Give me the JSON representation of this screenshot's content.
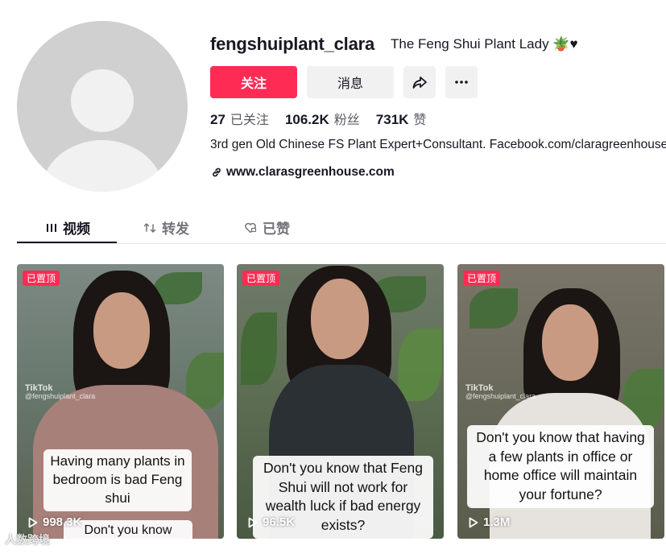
{
  "profile": {
    "username": "fengshuiplant_clara",
    "nickname": "The Feng Shui Plant Lady 🪴♥",
    "bio": "3rd gen Old Chinese FS Plant Expert+Consultant. Facebook.com/claragreenhouse",
    "link": "www.clarasgreenhouse.com"
  },
  "actions": {
    "follow_label": "关注",
    "message_label": "消息",
    "share_icon": "share-icon",
    "more_icon": "more-icon"
  },
  "stats": [
    {
      "value": "27",
      "label": "已关注"
    },
    {
      "value": "106.2K",
      "label": "粉丝"
    },
    {
      "value": "731K",
      "label": "赞"
    }
  ],
  "tabs": [
    {
      "label": "视频",
      "icon": "grid-icon",
      "active": true
    },
    {
      "label": "转发",
      "icon": "repost-icon",
      "active": false
    },
    {
      "label": "已赞",
      "icon": "heart-icon",
      "active": false
    }
  ],
  "videos": [
    {
      "pinned_label": "已置顶",
      "tiktok_label": "TikTok",
      "handle": "@fengshuiplant_clara",
      "caption": "Having many plants in bedroom is bad Feng shui",
      "bottom_text": "Don't you know that?",
      "views": "998.3K"
    },
    {
      "pinned_label": "已置顶",
      "tiktok_label": "",
      "handle": "",
      "caption": "Don't you know that Feng Shui will not work for wealth luck if bad energy exists?",
      "bottom_text": "",
      "views": "96.5K"
    },
    {
      "pinned_label": "已置顶",
      "tiktok_label": "TikTok",
      "handle": "@fengshuiplant_clara",
      "caption": "Don't you know that having a few plants in office or home office will maintain your fortune?",
      "bottom_text": "",
      "views": "1.3M"
    }
  ],
  "watermark": "人数跨境"
}
